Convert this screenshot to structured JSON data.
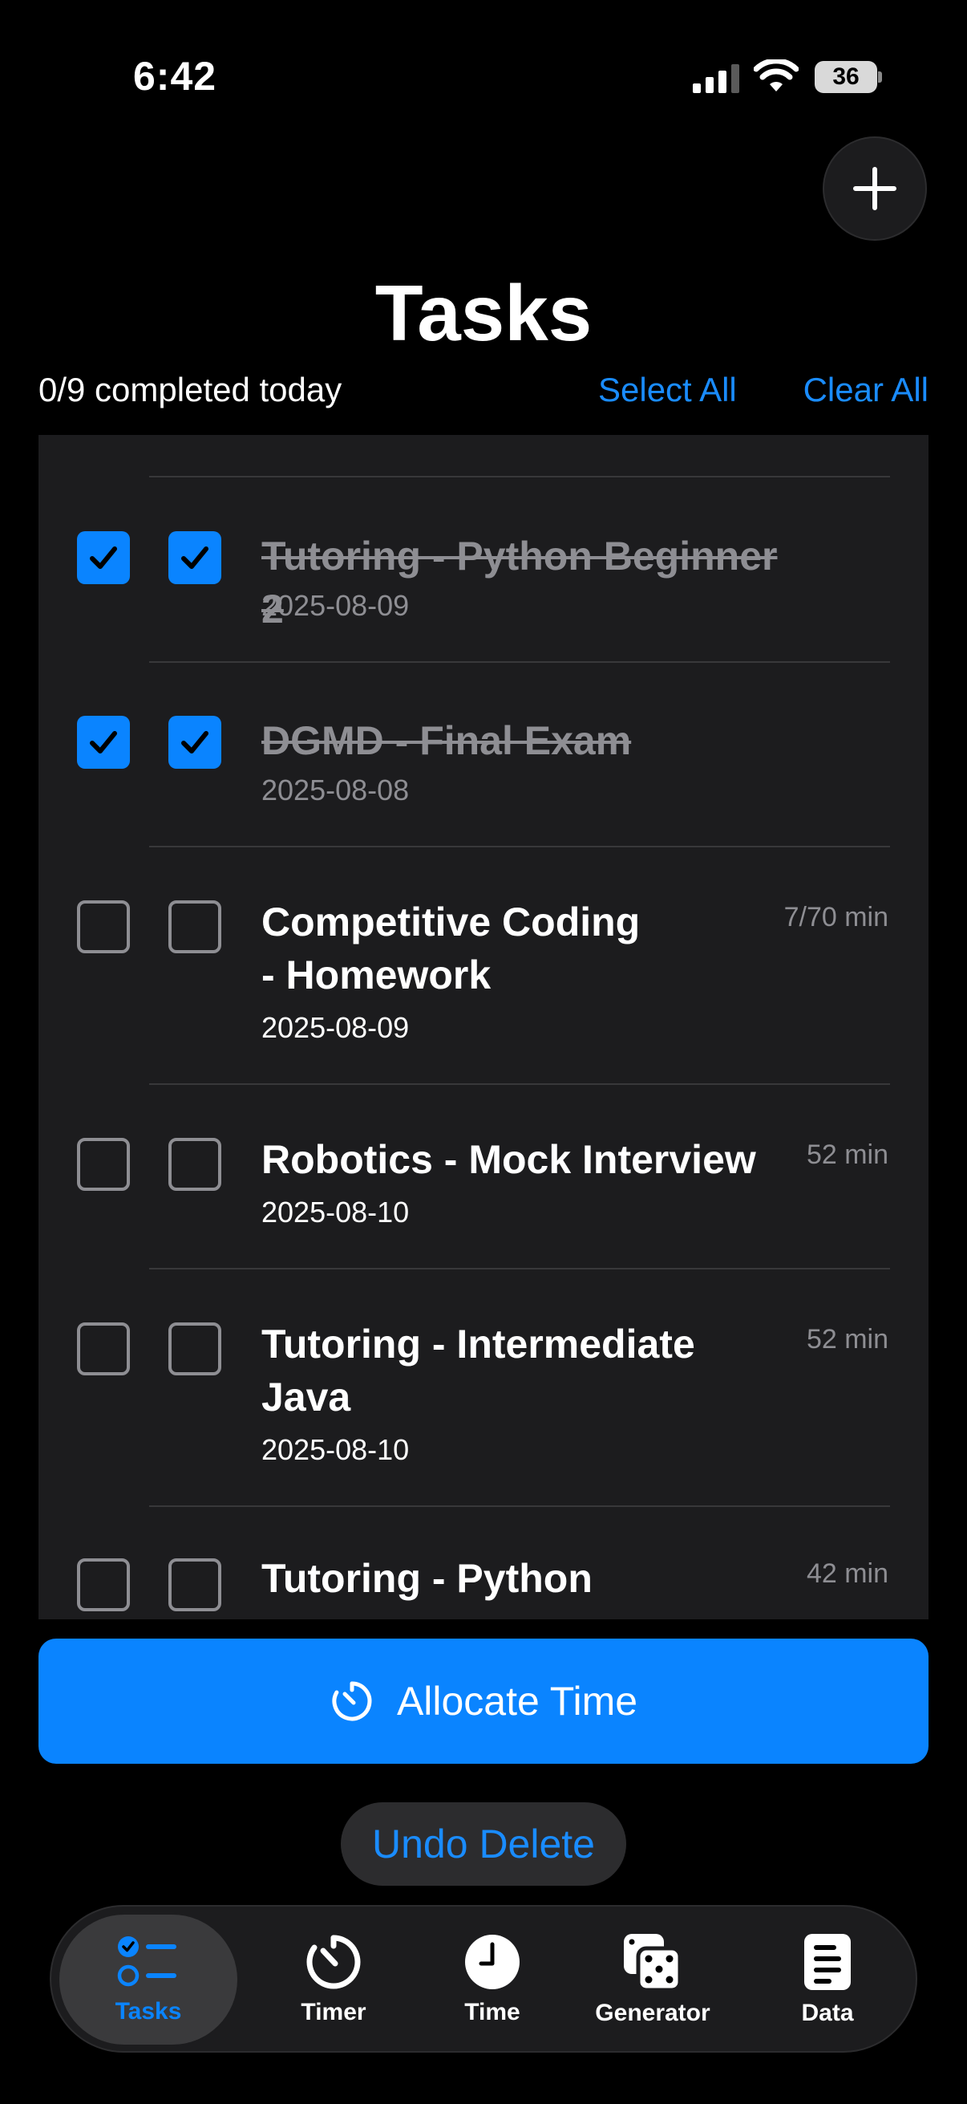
{
  "status_bar": {
    "time": "6:42",
    "battery": "36"
  },
  "header": {
    "title": "Tasks",
    "summary": "0/9 completed today",
    "select_all": "Select All",
    "clear_all": "Clear All"
  },
  "tasks": [
    {
      "title": "Tutoring - Python Beginner 2",
      "date": "2025-08-09",
      "duration": "",
      "done": true
    },
    {
      "title": "DGMD - Final Exam",
      "date": "2025-08-08",
      "duration": "",
      "done": true
    },
    {
      "title_line1": "Competitive Coding",
      "title_line2": "- Homework",
      "date": "2025-08-09",
      "duration": "7/70 min",
      "done": false
    },
    {
      "title": "Robotics - Mock Interview",
      "date": "2025-08-10",
      "duration": "52 min",
      "done": false
    },
    {
      "title_line1": "Tutoring - Intermediate",
      "title_line2": "Java",
      "date": "2025-08-10",
      "duration": "52 min",
      "done": false
    },
    {
      "title": "Tutoring - Python",
      "date": "",
      "duration": "42 min",
      "done": false
    }
  ],
  "actions": {
    "allocate": "Allocate Time",
    "undo": "Undo Delete"
  },
  "tabs": [
    {
      "label": "Tasks",
      "icon": "tasks-icon",
      "active": true
    },
    {
      "label": "Timer",
      "icon": "timer-icon"
    },
    {
      "label": "Time",
      "icon": "clock-icon"
    },
    {
      "label": "Generator",
      "icon": "dice-icon"
    },
    {
      "label": "Data",
      "icon": "document-icon"
    }
  ],
  "colors": {
    "accent": "#0a84ff",
    "link": "#1a8cff",
    "panel": "#1c1c1e",
    "muted": "#8e8e93"
  }
}
